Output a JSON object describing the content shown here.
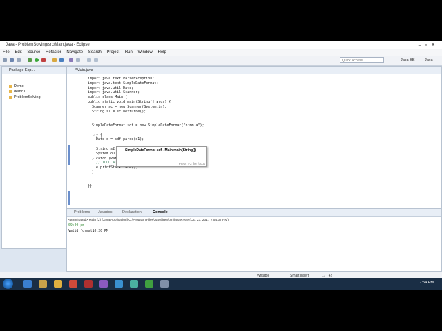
{
  "window": {
    "title": "Java - ProblemSolving/src/Main.java - Eclipse"
  },
  "menu": [
    "File",
    "Edit",
    "Source",
    "Refactor",
    "Navigate",
    "Search",
    "Project",
    "Run",
    "Window",
    "Help"
  ],
  "toolbar": {
    "quick_access_placeholder": "Quick Access",
    "perspective_java_ee": "Java EE",
    "perspective_java": "Java"
  },
  "package_explorer": {
    "title": "Package Exp...",
    "items": [
      "Demo",
      "demo1",
      "ProblemSolving"
    ]
  },
  "editor": {
    "tab_label": "*Main.java",
    "code_lines": [
      "import java.text.ParseException;",
      "import java.text.SimpleDateFormat;",
      "import java.util.Date;",
      "import java.util.Scanner;",
      "public class Main {",
      "public static void main(String[] args) {",
      "  Scanner sc = new Scanner(System.in);",
      "  String s1 = sc.nextLine();",
      "",
      "",
      "  SimpleDateFormat sdf = new SimpleDateFormat(\"h:mm a\");",
      "",
      "  try {",
      "    Date d = sdf.parse(s1);",
      "",
      "    String s2",
      "    System.ou",
      "  } catch (Pars",
      "    // TODO Auto-generated catch block",
      "    e.printStackTrace();",
      "  }",
      "",
      "",
      "}}"
    ],
    "tooltip_signature": "SimpleDateFormat sdf - Main.main(String[])",
    "tooltip_hint": "Press 'F2' for focus"
  },
  "console": {
    "tabs": [
      "Problems",
      "Javadoc",
      "Declaration",
      "Console"
    ],
    "terminated": "<terminated> Main (2) [Java Application] C:\\Program Files\\Java\\jre8\\bin\\javaw.exe (Oct 23, 2017 7:54:07 PM)",
    "input_echo": "09:00 pm",
    "output": "Valid format10:20 PM"
  },
  "status": {
    "writable": "Writable",
    "insert_mode": "Smart Insert",
    "position": "17 : 42"
  },
  "taskbar": {
    "time": "7:54 PM"
  }
}
